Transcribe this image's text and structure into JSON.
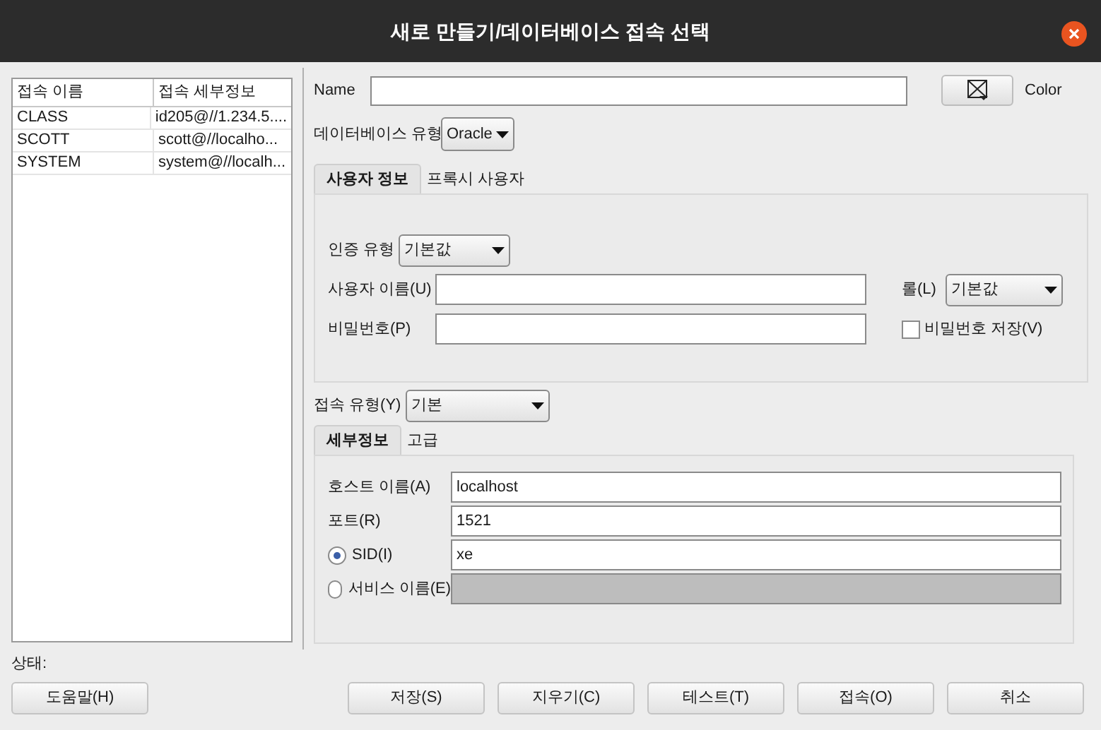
{
  "window": {
    "title": "새로 만들기/데이터베이스 접속 선택"
  },
  "connections": {
    "columns": [
      "접속 이름",
      "접속 세부정보"
    ],
    "rows": [
      {
        "name": "CLASS",
        "details": "id205@//1.234.5....",
        "selected": false
      },
      {
        "name": "SCOTT",
        "details": "scott@//localho...",
        "selected": false
      },
      {
        "name": "SYSTEM",
        "details": "system@//localh...",
        "selected": false
      }
    ]
  },
  "name_field": {
    "label": "Name"
  },
  "color_button": {
    "label": "Color"
  },
  "database_type": {
    "label": "데이터베이스 유형",
    "value": "Oracle"
  },
  "user_tabs": [
    {
      "label": "사용자 정보",
      "selected": true
    },
    {
      "label": "프록시 사용자",
      "selected": false
    }
  ],
  "auth_type": {
    "label": "인증 유형",
    "value": "기본값"
  },
  "username": {
    "label": "사용자 이름(U)"
  },
  "role": {
    "label": "롤(L)",
    "value": "기본값"
  },
  "password": {
    "label": "비밀번호(P)"
  },
  "save_password": {
    "label": "비밀번호 저장(V)",
    "checked": false
  },
  "connection_type": {
    "label": "접속 유형(Y)",
    "value": "기본"
  },
  "detail_tabs": [
    {
      "label": "세부정보",
      "selected": true
    },
    {
      "label": "고급",
      "selected": false
    }
  ],
  "details": [
    {
      "kind": "field",
      "label": "호스트 이름(A)",
      "value": "localhost",
      "disabled": false
    },
    {
      "kind": "field",
      "label": "포트(R)",
      "value": "1521",
      "disabled": false
    },
    {
      "kind": "radio",
      "label": "SID(I)",
      "value": "xe",
      "selected": true,
      "disabled": false
    },
    {
      "kind": "radio",
      "label": "서비스 이름(E)",
      "selected": false,
      "disabled": true
    }
  ],
  "status": {
    "label": "상태:"
  },
  "help_button": "도움말(H)",
  "buttons": [
    "저장(S)",
    "지우기(C)",
    "테스트(T)",
    "접속(O)",
    "취소"
  ]
}
